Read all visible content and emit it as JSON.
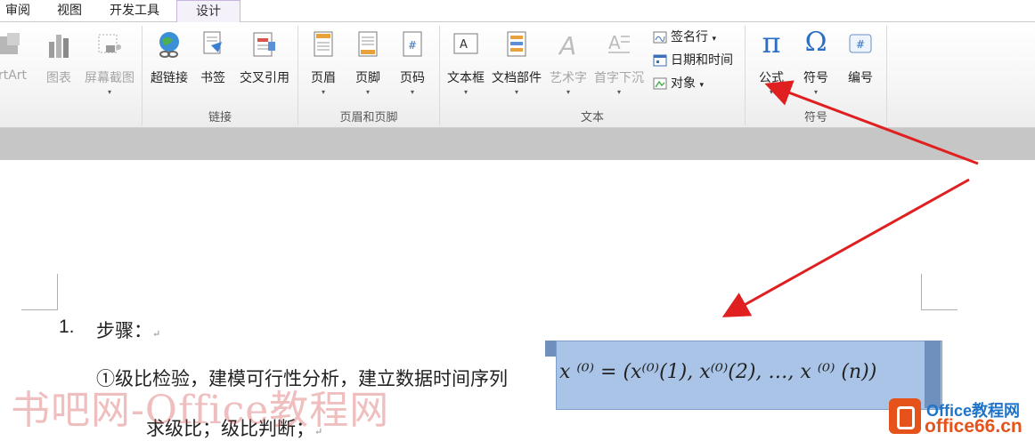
{
  "tabs": [
    {
      "label": "审阅"
    },
    {
      "label": "视图"
    },
    {
      "label": "开发工具"
    },
    {
      "label": "设计"
    }
  ],
  "ribbon": {
    "partial_left": {
      "label": "rtArt"
    },
    "chart": {
      "label": "图表"
    },
    "screenshot": {
      "label": "屏幕截图"
    },
    "links": {
      "group_label": "链接",
      "hyperlink": "超链接",
      "bookmark": "书签",
      "cross_ref": "交叉引用"
    },
    "header_footer": {
      "group_label": "页眉和页脚",
      "header": "页眉",
      "footer": "页脚",
      "page_number": "页码"
    },
    "text": {
      "group_label": "文本",
      "textbox": "文本框",
      "quickparts": "文档部件",
      "wordart": "艺术字",
      "dropcap": "首字下沉",
      "signature": "签名行",
      "datetime": "日期和时间",
      "object": "对象"
    },
    "symbols": {
      "group_label": "符号",
      "equation": "公式",
      "equation_glyph": "π",
      "symbol": "符号",
      "symbol_glyph": "Ω",
      "number": "编号"
    }
  },
  "document": {
    "line1_num": "1.",
    "line1_text": "步骤：",
    "line2_text": "①级比检验，建模可行性分析，建立数据时间序列",
    "equation": "x ⁽⁰⁾ = (x⁽⁰⁾(1), x⁽⁰⁾(2), …, x ⁽⁰⁾ (n))",
    "line3_text": "求级比；级比判断；",
    "para_mark": "↵"
  },
  "watermark": {
    "left_text": "书吧网-Office教程网",
    "logo_top": "Office教程网",
    "logo_bottom": "office66.cn"
  },
  "colors": {
    "annotation_arrow": "#e02020",
    "equation_highlight": "#a9c4e6",
    "tab_active_border": "#c7b5e0"
  }
}
